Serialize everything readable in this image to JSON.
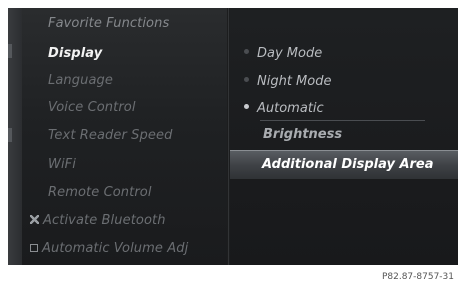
{
  "left_menu": {
    "items": [
      {
        "label": "Favorite Functions",
        "state": "dim"
      },
      {
        "label": "Display",
        "state": "active"
      },
      {
        "label": "Language",
        "state": "normal"
      },
      {
        "label": "Voice Control",
        "state": "normal"
      },
      {
        "label": "Text Reader Speed",
        "state": "normal"
      },
      {
        "label": "WiFi",
        "state": "normal"
      },
      {
        "label": "Remote Control",
        "state": "normal"
      },
      {
        "label": "Activate Bluetooth",
        "state": "checked"
      },
      {
        "label": "Automatic Volume Adj",
        "state": "unchecked"
      }
    ]
  },
  "display_menu": {
    "mode_options": [
      {
        "label": "Day Mode",
        "selected": false
      },
      {
        "label": "Night Mode",
        "selected": false
      },
      {
        "label": "Automatic",
        "selected": true
      }
    ],
    "brightness_label": "Brightness",
    "additional_area_label": "Additional Display Area"
  },
  "caption": "P82.87-8757-31",
  "colors": {
    "screen_bg": "#151617",
    "active_text": "#f2f2f2",
    "inactive_text": "#6b6e72",
    "highlight_bar": "#4a4e52"
  }
}
